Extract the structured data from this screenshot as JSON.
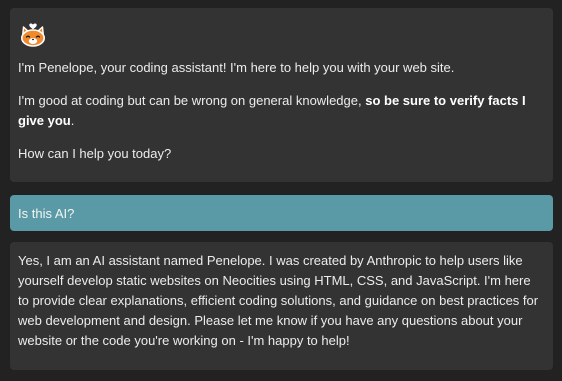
{
  "assistant": {
    "avatar_icon": "cat-face-heart-icon",
    "intro_line1": "I'm Penelope, your coding assistant! I'm here to help you with your web site.",
    "intro_line2_prefix": "I'm good at coding but can be wrong on general knowledge, ",
    "intro_line2_bold": "so be sure to verify facts I give you",
    "intro_line2_suffix": ".",
    "intro_line3": "How can I help you today?"
  },
  "user_message": {
    "text": "Is this AI?"
  },
  "assistant_reply": {
    "text": "Yes, I am an AI assistant named Penelope. I was created by Anthropic to help users like yourself develop static websites on Neocities using HTML, CSS, and JavaScript. I'm here to provide clear explanations, efficient coding solutions, and guidance on best practices for web development and design. Please let me know if you have any questions about your website or the code you're working on - I'm happy to help!"
  },
  "colors": {
    "page_bg": "#222222",
    "assistant_bubble": "#333333",
    "user_bubble": "#5a99a6",
    "text": "#ececec"
  }
}
